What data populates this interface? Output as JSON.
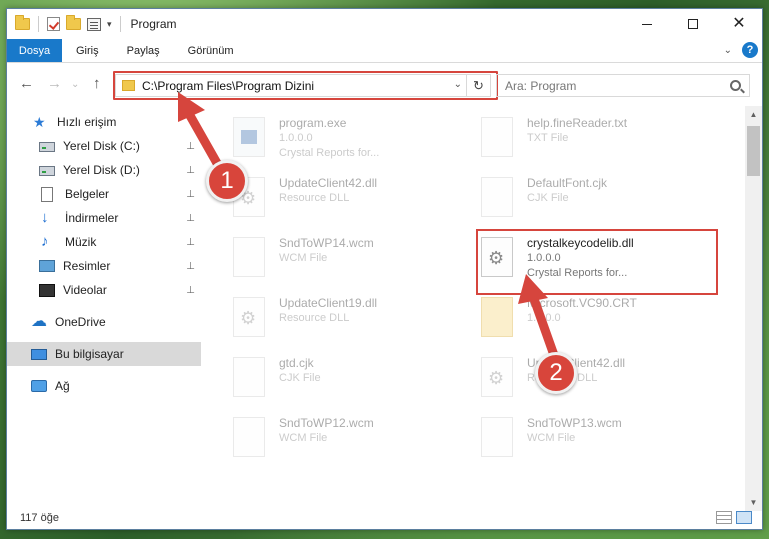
{
  "window": {
    "title": "Program",
    "controls": {
      "minimize": "—",
      "maximize": "□",
      "close": "✕"
    }
  },
  "ribbon": {
    "tabs": [
      "Dosya",
      "Giriş",
      "Paylaş",
      "Görünüm"
    ]
  },
  "address": {
    "path": "C:\\Program Files\\Program Dizini",
    "refresh_glyph": "↻",
    "dropdown_glyph": "⌄"
  },
  "search": {
    "placeholder": "Ara: Program"
  },
  "nav": {
    "back": "←",
    "forward": "→",
    "up": "↑",
    "recent": "⌄"
  },
  "sidebar": {
    "items": [
      {
        "label": "Hızlı erişim",
        "icon": "star-icon"
      },
      {
        "label": "Yerel Disk (C:)",
        "icon": "disk-icon",
        "pinned": true
      },
      {
        "label": "Yerel Disk (D:)",
        "icon": "disk-icon",
        "pinned": true
      },
      {
        "label": "Belgeler",
        "icon": "document-icon",
        "pinned": true
      },
      {
        "label": "İndirmeler",
        "icon": "download-icon",
        "pinned": true
      },
      {
        "label": "Müzik",
        "icon": "music-icon",
        "pinned": true
      },
      {
        "label": "Resimler",
        "icon": "pictures-icon",
        "pinned": true
      },
      {
        "label": "Videolar",
        "icon": "video-icon",
        "pinned": true
      },
      {
        "label": "OneDrive",
        "icon": "cloud-icon"
      },
      {
        "label": "Bu bilgisayar",
        "icon": "computer-icon",
        "selected": true
      },
      {
        "label": "Ağ",
        "icon": "network-icon"
      }
    ],
    "pin_glyph": "📌"
  },
  "files": [
    {
      "name": "program.exe",
      "line2": "1.0.0.0",
      "line3": "Crystal Reports for...",
      "type": "exe"
    },
    {
      "name": "help.fineReader.txt",
      "line2": "TXT File",
      "line3": "",
      "type": "doc"
    },
    {
      "name": "UpdateClient42.dll",
      "line2": "Resource DLL",
      "line3": "",
      "type": "dll"
    },
    {
      "name": "DefaultFont.cjk",
      "line2": "CJK File",
      "line3": "",
      "type": "doc"
    },
    {
      "name": "SndToWP14.wcm",
      "line2": "WCM File",
      "line3": "",
      "type": "doc"
    },
    {
      "name": "crystalkeycodelib.dll",
      "line2": "1.0.0.0",
      "line3": "Crystal Reports for...",
      "type": "dll"
    },
    {
      "name": "UpdateClient19.dll",
      "line2": "Resource DLL",
      "line3": "",
      "type": "dll"
    },
    {
      "name": "Microsoft.VC90.CRT",
      "line2": "1.0.0.0",
      "line3": "",
      "type": "folder"
    },
    {
      "name": "gtd.cjk",
      "line2": "CJK File",
      "line3": "",
      "type": "doc"
    },
    {
      "name": "UpdateClient42.dll",
      "line2": "Resource DLL",
      "line3": "",
      "type": "dll"
    },
    {
      "name": "SndToWP12.wcm",
      "line2": "WCM File",
      "line3": "",
      "type": "doc"
    },
    {
      "name": "SndToWP13.wcm",
      "line2": "WCM File",
      "line3": "",
      "type": "doc"
    }
  ],
  "status": {
    "count": "117 öğe"
  },
  "annotations": {
    "step1": "1",
    "step2": "2",
    "color": "#d6453d"
  },
  "colors": {
    "accent": "#1979ca",
    "selected": "#d9d9d9"
  }
}
